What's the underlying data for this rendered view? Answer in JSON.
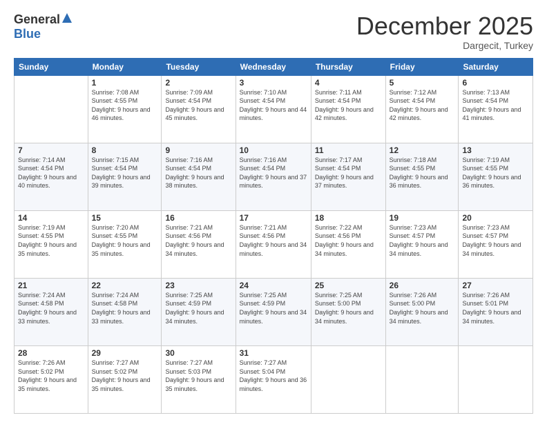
{
  "header": {
    "logo_general": "General",
    "logo_blue": "Blue",
    "month_title": "December 2025",
    "location": "Dargecit, Turkey"
  },
  "calendar": {
    "weekdays": [
      "Sunday",
      "Monday",
      "Tuesday",
      "Wednesday",
      "Thursday",
      "Friday",
      "Saturday"
    ],
    "weeks": [
      [
        {
          "day": "",
          "sunrise": "",
          "sunset": "",
          "daylight": ""
        },
        {
          "day": "1",
          "sunrise": "Sunrise: 7:08 AM",
          "sunset": "Sunset: 4:55 PM",
          "daylight": "Daylight: 9 hours and 46 minutes."
        },
        {
          "day": "2",
          "sunrise": "Sunrise: 7:09 AM",
          "sunset": "Sunset: 4:54 PM",
          "daylight": "Daylight: 9 hours and 45 minutes."
        },
        {
          "day": "3",
          "sunrise": "Sunrise: 7:10 AM",
          "sunset": "Sunset: 4:54 PM",
          "daylight": "Daylight: 9 hours and 44 minutes."
        },
        {
          "day": "4",
          "sunrise": "Sunrise: 7:11 AM",
          "sunset": "Sunset: 4:54 PM",
          "daylight": "Daylight: 9 hours and 42 minutes."
        },
        {
          "day": "5",
          "sunrise": "Sunrise: 7:12 AM",
          "sunset": "Sunset: 4:54 PM",
          "daylight": "Daylight: 9 hours and 42 minutes."
        },
        {
          "day": "6",
          "sunrise": "Sunrise: 7:13 AM",
          "sunset": "Sunset: 4:54 PM",
          "daylight": "Daylight: 9 hours and 41 minutes."
        }
      ],
      [
        {
          "day": "7",
          "sunrise": "Sunrise: 7:14 AM",
          "sunset": "Sunset: 4:54 PM",
          "daylight": "Daylight: 9 hours and 40 minutes."
        },
        {
          "day": "8",
          "sunrise": "Sunrise: 7:15 AM",
          "sunset": "Sunset: 4:54 PM",
          "daylight": "Daylight: 9 hours and 39 minutes."
        },
        {
          "day": "9",
          "sunrise": "Sunrise: 7:16 AM",
          "sunset": "Sunset: 4:54 PM",
          "daylight": "Daylight: 9 hours and 38 minutes."
        },
        {
          "day": "10",
          "sunrise": "Sunrise: 7:16 AM",
          "sunset": "Sunset: 4:54 PM",
          "daylight": "Daylight: 9 hours and 37 minutes."
        },
        {
          "day": "11",
          "sunrise": "Sunrise: 7:17 AM",
          "sunset": "Sunset: 4:54 PM",
          "daylight": "Daylight: 9 hours and 37 minutes."
        },
        {
          "day": "12",
          "sunrise": "Sunrise: 7:18 AM",
          "sunset": "Sunset: 4:55 PM",
          "daylight": "Daylight: 9 hours and 36 minutes."
        },
        {
          "day": "13",
          "sunrise": "Sunrise: 7:19 AM",
          "sunset": "Sunset: 4:55 PM",
          "daylight": "Daylight: 9 hours and 36 minutes."
        }
      ],
      [
        {
          "day": "14",
          "sunrise": "Sunrise: 7:19 AM",
          "sunset": "Sunset: 4:55 PM",
          "daylight": "Daylight: 9 hours and 35 minutes."
        },
        {
          "day": "15",
          "sunrise": "Sunrise: 7:20 AM",
          "sunset": "Sunset: 4:55 PM",
          "daylight": "Daylight: 9 hours and 35 minutes."
        },
        {
          "day": "16",
          "sunrise": "Sunrise: 7:21 AM",
          "sunset": "Sunset: 4:56 PM",
          "daylight": "Daylight: 9 hours and 34 minutes."
        },
        {
          "day": "17",
          "sunrise": "Sunrise: 7:21 AM",
          "sunset": "Sunset: 4:56 PM",
          "daylight": "Daylight: 9 hours and 34 minutes."
        },
        {
          "day": "18",
          "sunrise": "Sunrise: 7:22 AM",
          "sunset": "Sunset: 4:56 PM",
          "daylight": "Daylight: 9 hours and 34 minutes."
        },
        {
          "day": "19",
          "sunrise": "Sunrise: 7:23 AM",
          "sunset": "Sunset: 4:57 PM",
          "daylight": "Daylight: 9 hours and 34 minutes."
        },
        {
          "day": "20",
          "sunrise": "Sunrise: 7:23 AM",
          "sunset": "Sunset: 4:57 PM",
          "daylight": "Daylight: 9 hours and 34 minutes."
        }
      ],
      [
        {
          "day": "21",
          "sunrise": "Sunrise: 7:24 AM",
          "sunset": "Sunset: 4:58 PM",
          "daylight": "Daylight: 9 hours and 33 minutes."
        },
        {
          "day": "22",
          "sunrise": "Sunrise: 7:24 AM",
          "sunset": "Sunset: 4:58 PM",
          "daylight": "Daylight: 9 hours and 33 minutes."
        },
        {
          "day": "23",
          "sunrise": "Sunrise: 7:25 AM",
          "sunset": "Sunset: 4:59 PM",
          "daylight": "Daylight: 9 hours and 34 minutes."
        },
        {
          "day": "24",
          "sunrise": "Sunrise: 7:25 AM",
          "sunset": "Sunset: 4:59 PM",
          "daylight": "Daylight: 9 hours and 34 minutes."
        },
        {
          "day": "25",
          "sunrise": "Sunrise: 7:25 AM",
          "sunset": "Sunset: 5:00 PM",
          "daylight": "Daylight: 9 hours and 34 minutes."
        },
        {
          "day": "26",
          "sunrise": "Sunrise: 7:26 AM",
          "sunset": "Sunset: 5:00 PM",
          "daylight": "Daylight: 9 hours and 34 minutes."
        },
        {
          "day": "27",
          "sunrise": "Sunrise: 7:26 AM",
          "sunset": "Sunset: 5:01 PM",
          "daylight": "Daylight: 9 hours and 34 minutes."
        }
      ],
      [
        {
          "day": "28",
          "sunrise": "Sunrise: 7:26 AM",
          "sunset": "Sunset: 5:02 PM",
          "daylight": "Daylight: 9 hours and 35 minutes."
        },
        {
          "day": "29",
          "sunrise": "Sunrise: 7:27 AM",
          "sunset": "Sunset: 5:02 PM",
          "daylight": "Daylight: 9 hours and 35 minutes."
        },
        {
          "day": "30",
          "sunrise": "Sunrise: 7:27 AM",
          "sunset": "Sunset: 5:03 PM",
          "daylight": "Daylight: 9 hours and 35 minutes."
        },
        {
          "day": "31",
          "sunrise": "Sunrise: 7:27 AM",
          "sunset": "Sunset: 5:04 PM",
          "daylight": "Daylight: 9 hours and 36 minutes."
        },
        {
          "day": "",
          "sunrise": "",
          "sunset": "",
          "daylight": ""
        },
        {
          "day": "",
          "sunrise": "",
          "sunset": "",
          "daylight": ""
        },
        {
          "day": "",
          "sunrise": "",
          "sunset": "",
          "daylight": ""
        }
      ]
    ]
  }
}
